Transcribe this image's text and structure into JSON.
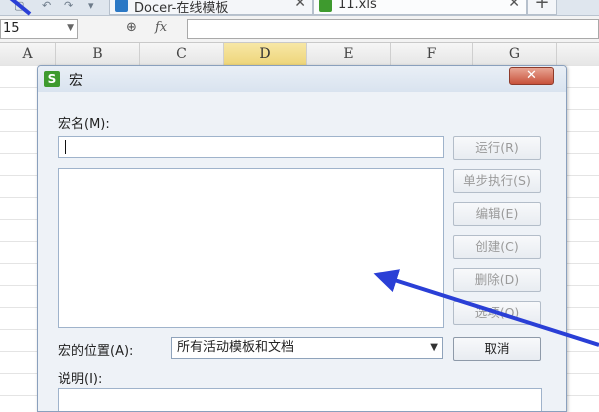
{
  "app": {
    "tabs": [
      {
        "label": "Docer-在线模板",
        "icon": "docer-icon"
      },
      {
        "label": "11.xls",
        "icon": "spreadsheet-icon"
      }
    ]
  },
  "formula_bar": {
    "name_box": "15",
    "fx_label": "fx"
  },
  "columns": [
    "A",
    "B",
    "C",
    "D",
    "E",
    "F",
    "G"
  ],
  "selected_column": "D",
  "dialog": {
    "icon_letter": "S",
    "title": "宏",
    "close_glyph": "✕",
    "macro_name_label": "宏名(M):",
    "macro_name_value": "",
    "location_label": "宏的位置(A):",
    "location_value": "所有活动模板和文档",
    "description_label": "说明(I):",
    "buttons": {
      "run": "运行(R)",
      "step": "单步执行(S)",
      "edit": "编辑(E)",
      "create": "创建(C)",
      "delete": "删除(D)",
      "options": "选项(O)",
      "cancel": "取消"
    }
  },
  "colors": {
    "annotation_arrow": "#2a3fd6",
    "dialog_icon": "#3e9a2e",
    "close_button": "#c8523b"
  }
}
